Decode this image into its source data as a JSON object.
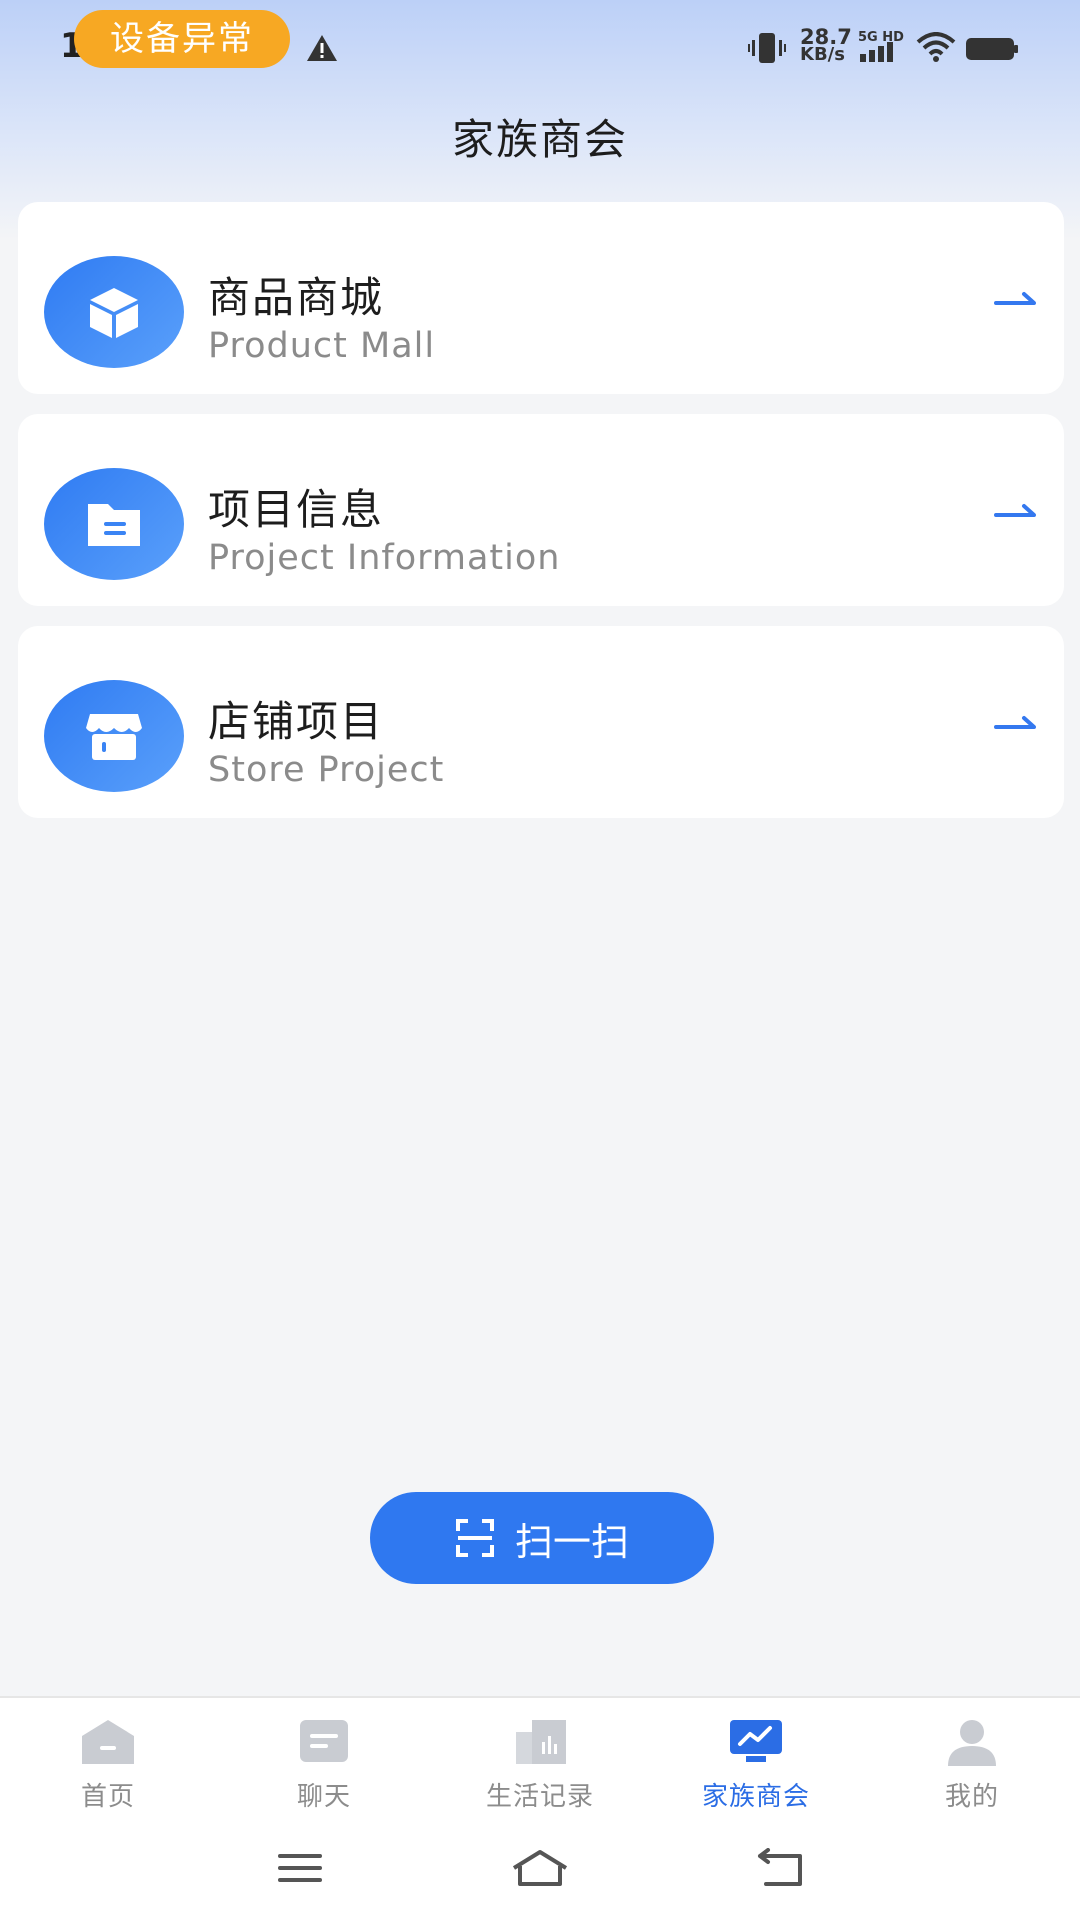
{
  "status_bar": {
    "time": "1",
    "alert": "设备异常",
    "net_speed_value": "28.7",
    "net_speed_unit": "KB/s",
    "network_label": "5G HD"
  },
  "header": {
    "title": "家族商会"
  },
  "cards": [
    {
      "title": "商品商城",
      "subtitle": "Product Mall",
      "icon": "box-icon"
    },
    {
      "title": "项目信息",
      "subtitle": "Project Information",
      "icon": "folder-icon"
    },
    {
      "title": "店铺项目",
      "subtitle": "Store Project",
      "icon": "store-icon"
    }
  ],
  "scan_button": {
    "label": "扫一扫",
    "icon": "scan-icon"
  },
  "tabs": [
    {
      "label": "首页",
      "icon": "home-icon",
      "active": false
    },
    {
      "label": "聊天",
      "icon": "chat-icon",
      "active": false
    },
    {
      "label": "生活记录",
      "icon": "chart-icon",
      "active": false
    },
    {
      "label": "家族商会",
      "icon": "monitor-trend-icon",
      "active": true
    },
    {
      "label": "我的",
      "icon": "user-icon",
      "active": false
    }
  ],
  "colors": {
    "accent": "#2f78f0",
    "alert": "#f7a823",
    "active_tab": "#2b6de5",
    "inactive_tab": "#8c8c8c"
  }
}
